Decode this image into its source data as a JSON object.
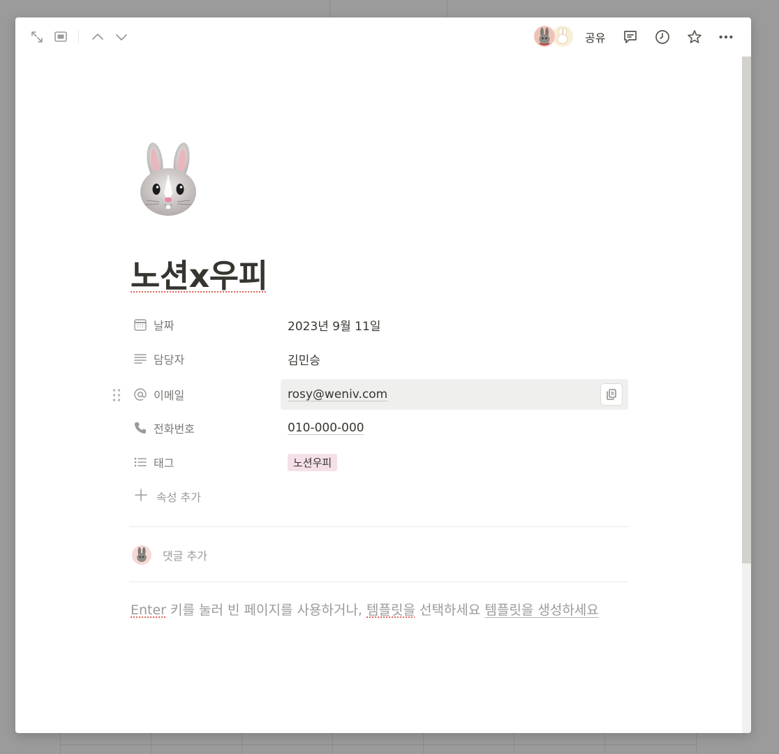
{
  "window": {
    "topbar": {
      "share_label": "공유"
    }
  },
  "page": {
    "icon": "rabbit-face-emoji",
    "title": "노션x우피"
  },
  "properties": [
    {
      "name": "날짜",
      "icon": "calendar-icon",
      "value": "2023년 9월 11일",
      "type": "date"
    },
    {
      "name": "담당자",
      "icon": "text-lines-icon",
      "value": "김민승",
      "type": "text"
    },
    {
      "name": "이메일",
      "icon": "at-sign-icon",
      "value": "rosy@weniv.com",
      "type": "email"
    },
    {
      "name": "전화번호",
      "icon": "phone-icon",
      "value": "010-000-000",
      "type": "phone"
    },
    {
      "name": "태그",
      "icon": "list-icon",
      "value": "노션우피",
      "type": "multi_select"
    }
  ],
  "add_property_label": "속성 추가",
  "comment": {
    "placeholder": "댓글 추가"
  },
  "empty_hint": {
    "enter_word": "Enter",
    "text": " 키를 눌러 빈 페이지를 사용하거나, ",
    "template_word": "템플릿을",
    "select_text": " 선택하세요 ",
    "create_link": "템플릿을 생성하세요"
  },
  "colors": {
    "tag_background": "#f5e0e9",
    "spellcheck_underline": "#e16259",
    "muted_text": "#9b9a97"
  }
}
